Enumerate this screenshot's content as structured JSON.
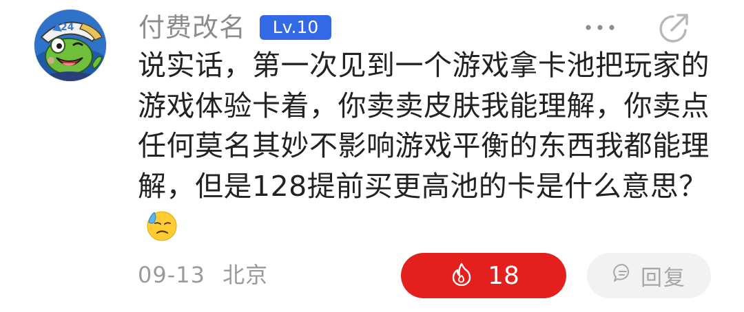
{
  "comment": {
    "username": "付费改名",
    "level": "Lv.10",
    "text": "说实话，第一次见到一个游戏拿卡池把玩家的游戏体验卡着，你卖卖皮肤我能理解，你卖点任何莫名其妙不影响游戏平衡的东西我都能理解，但是128提前买更高池的卡是什么意思？",
    "emoji": "downcast-face-with-sweat",
    "date": "09-13",
    "location": "北京",
    "likes": "18",
    "reply_label": "回复"
  },
  "colors": {
    "level_badge": "#3369e7",
    "like_button": "#e4201e",
    "username": "#8c8c8c",
    "meta_text": "#9a9a9a",
    "reply_bg": "#f2f2f2"
  },
  "icons": {
    "more": "more-horizontal-icon",
    "share": "share-arrow-icon",
    "like": "flame-icon",
    "reply": "speech-bubble-icon"
  }
}
